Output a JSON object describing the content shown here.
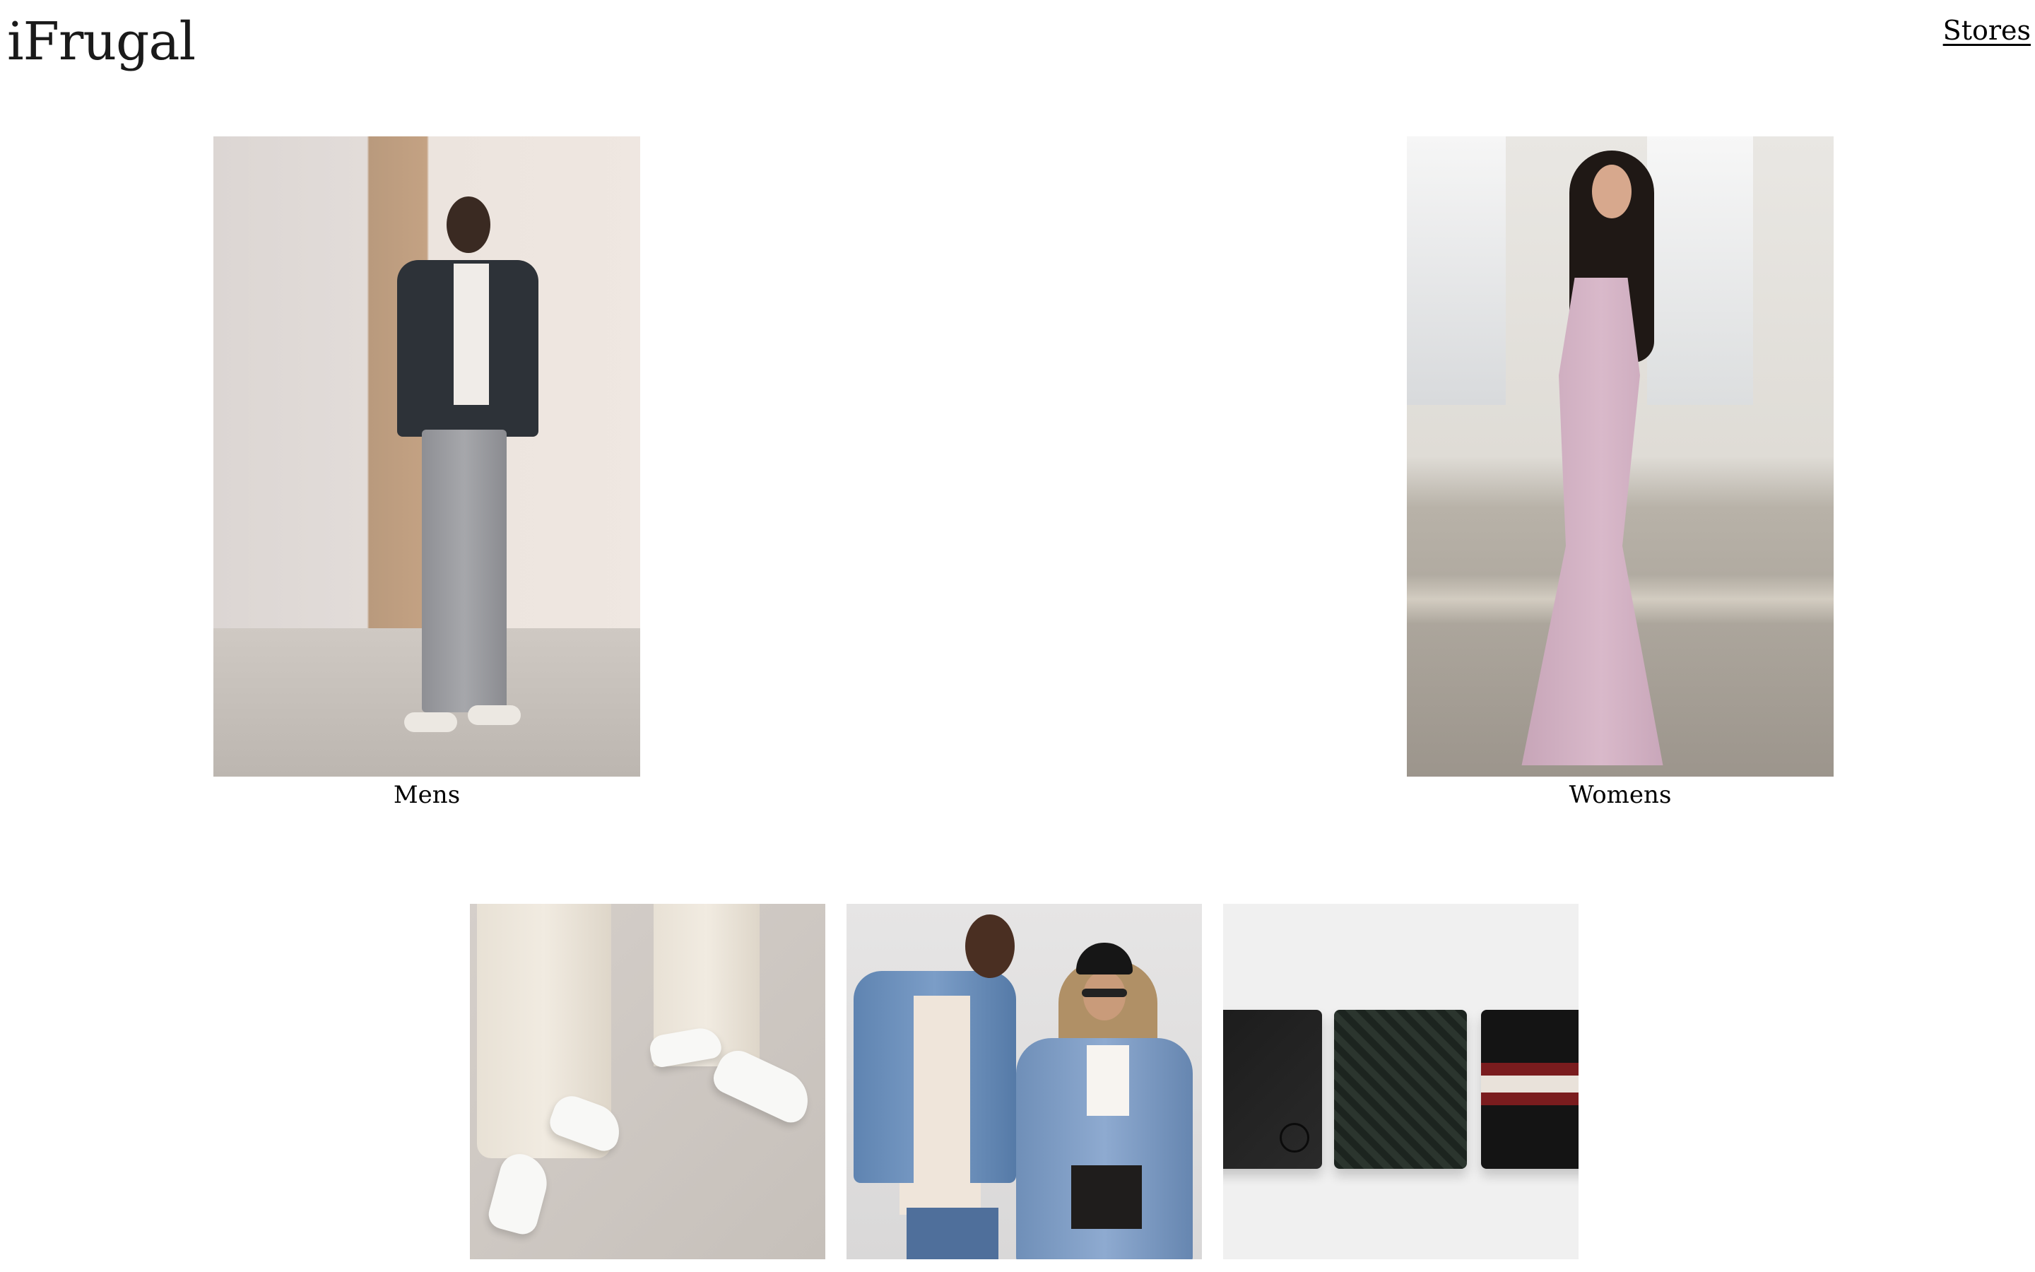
{
  "header": {
    "logo": "iFrugal",
    "nav_link": "Stores"
  },
  "categories": [
    {
      "label": "Mens",
      "image": "man-in-leather-jacket-photo"
    },
    {
      "label": "Womens",
      "image": "woman-in-pink-gown-photo"
    }
  ],
  "tiles": [
    {
      "image": "white-sneakers-cream-trousers-photo"
    },
    {
      "image": "denim-jackets-couple-photo"
    },
    {
      "image": "leather-wallets-photo"
    }
  ],
  "colors": {
    "background": "#ffffff",
    "text": "#111111",
    "link": "#000000"
  }
}
